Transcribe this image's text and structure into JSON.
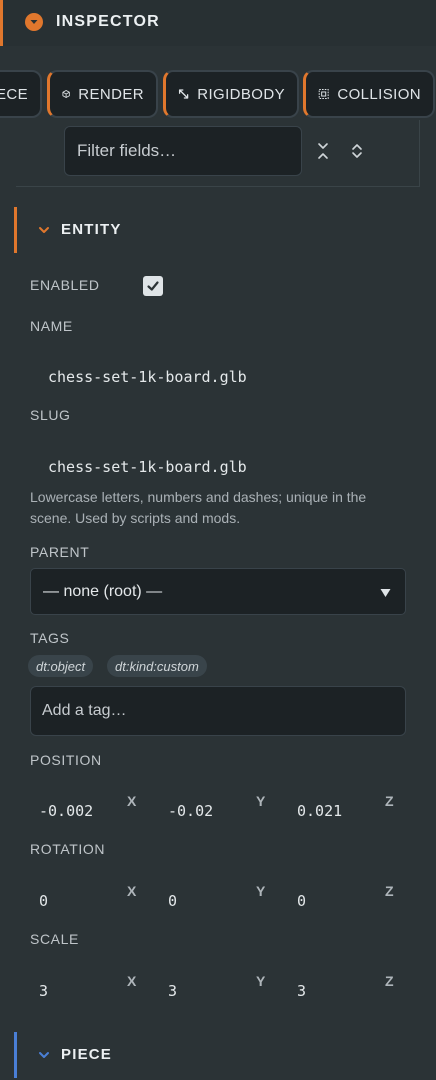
{
  "header": {
    "title": "INSPECTOR"
  },
  "tabs": [
    {
      "label": "ECE"
    },
    {
      "label": "RENDER",
      "icon": "cube-icon"
    },
    {
      "label": "RIGIDBODY",
      "icon": "resize-icon"
    },
    {
      "label": "COLLISION",
      "icon": "bounding-box-icon"
    }
  ],
  "filter": {
    "placeholder": "Filter fields…"
  },
  "entity": {
    "title": "ENTITY",
    "enabled_label": "ENABLED",
    "enabled": true,
    "name_label": "NAME",
    "name_value": "chess-set-1k-board.glb",
    "slug_label": "SLUG",
    "slug_value": "chess-set-1k-board.glb",
    "slug_help": "Lowercase letters, numbers and dashes; unique in the scene. Used by scripts and mods.",
    "parent_label": "PARENT",
    "parent_value": "— none (root) —",
    "tags_label": "TAGS",
    "tags": [
      "dt:object",
      "dt:kind:custom"
    ],
    "tag_placeholder": "Add a tag…",
    "position_label": "POSITION",
    "position": {
      "x": "-0.002",
      "y": "-0.02",
      "z": "0.021"
    },
    "rotation_label": "ROTATION",
    "rotation": {
      "x": "0",
      "y": "0",
      "z": "0"
    },
    "scale_label": "SCALE",
    "scale": {
      "x": "3",
      "y": "3",
      "z": "3"
    },
    "axis_labels": {
      "x": "X",
      "y": "Y",
      "z": "Z"
    }
  },
  "piece": {
    "title": "PIECE"
  },
  "colors": {
    "background": "#2b3336",
    "accent_orange": "#e0772d",
    "accent_blue": "#4a7fd6",
    "field_bg": "#1c2225"
  }
}
